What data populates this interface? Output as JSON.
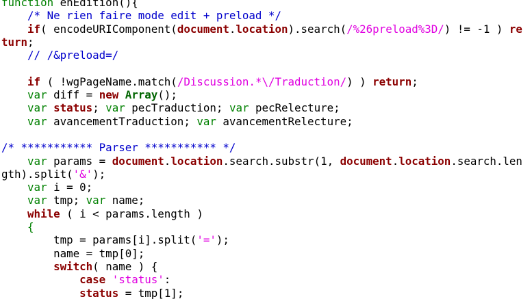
{
  "editor": {
    "language": "javascript",
    "colors": {
      "keyword": "#008000",
      "bold_keyword": "#8b0000",
      "comment": "#0000cc",
      "string": "#e000e0",
      "plain": "#000000",
      "background": "#ffffff"
    },
    "lines": [
      [
        [
          "kw",
          "function"
        ],
        [
          "plain",
          " enEdition(){"
        ]
      ],
      [
        [
          "plain",
          "    "
        ],
        [
          "cm",
          "/* Ne rien faire mode edit + preload */"
        ]
      ],
      [
        [
          "plain",
          "    "
        ],
        [
          "kwb",
          "if"
        ],
        [
          "plain",
          "( encodeURIComponent("
        ],
        [
          "var",
          "document"
        ],
        [
          "plain",
          "."
        ],
        [
          "var",
          "location"
        ],
        [
          "plain",
          ").search("
        ],
        [
          "str",
          "/%26preload%3D/"
        ],
        [
          "plain",
          ") != -1 ) "
        ],
        [
          "kwb",
          "re"
        ]
      ],
      [
        [
          "kwb",
          "turn"
        ],
        [
          "plain",
          ";"
        ]
      ],
      [
        [
          "plain",
          "    "
        ],
        [
          "cm",
          "// /&preload=/"
        ]
      ],
      [
        [
          "plain",
          ""
        ]
      ],
      [
        [
          "plain",
          "    "
        ],
        [
          "kwb",
          "if"
        ],
        [
          "plain",
          " ( !wgPageName.match("
        ],
        [
          "str",
          "/Discussion.*\\/Traduction/"
        ],
        [
          "plain",
          ") ) "
        ],
        [
          "kwb",
          "return"
        ],
        [
          "plain",
          ";"
        ]
      ],
      [
        [
          "plain",
          "    "
        ],
        [
          "kw",
          "var"
        ],
        [
          "plain",
          " diff = "
        ],
        [
          "kwb",
          "new"
        ],
        [
          "plain",
          " "
        ],
        [
          "cls",
          "Array"
        ],
        [
          "plain",
          "();"
        ]
      ],
      [
        [
          "plain",
          "    "
        ],
        [
          "kw",
          "var"
        ],
        [
          "plain",
          " "
        ],
        [
          "var",
          "status"
        ],
        [
          "plain",
          "; "
        ],
        [
          "kw",
          "var"
        ],
        [
          "plain",
          " pecTraduction; "
        ],
        [
          "kw",
          "var"
        ],
        [
          "plain",
          " pecRelecture;"
        ]
      ],
      [
        [
          "plain",
          "    "
        ],
        [
          "kw",
          "var"
        ],
        [
          "plain",
          " avancementTraduction; "
        ],
        [
          "kw",
          "var"
        ],
        [
          "plain",
          " avancementRelecture;"
        ]
      ],
      [
        [
          "plain",
          ""
        ]
      ],
      [
        [
          "cm",
          "/* *********** Parser *********** */"
        ]
      ],
      [
        [
          "plain",
          "    "
        ],
        [
          "kw",
          "var"
        ],
        [
          "plain",
          " params = "
        ],
        [
          "var",
          "document"
        ],
        [
          "plain",
          "."
        ],
        [
          "var",
          "location"
        ],
        [
          "plain",
          ".search.substr(1, "
        ],
        [
          "var",
          "document"
        ],
        [
          "plain",
          "."
        ],
        [
          "var",
          "location"
        ],
        [
          "plain",
          ".search.len"
        ]
      ],
      [
        [
          "plain",
          "gth).split("
        ],
        [
          "str",
          "'&'"
        ],
        [
          "plain",
          ");"
        ]
      ],
      [
        [
          "plain",
          "    "
        ],
        [
          "kw",
          "var"
        ],
        [
          "plain",
          " i = 0;"
        ]
      ],
      [
        [
          "plain",
          "    "
        ],
        [
          "kw",
          "var"
        ],
        [
          "plain",
          " tmp; "
        ],
        [
          "kw",
          "var"
        ],
        [
          "plain",
          " name;"
        ]
      ],
      [
        [
          "plain",
          "    "
        ],
        [
          "kwb",
          "while"
        ],
        [
          "plain",
          " ( i < params.length )"
        ]
      ],
      [
        [
          "plain",
          "    "
        ],
        [
          "kw",
          "{"
        ]
      ],
      [
        [
          "plain",
          "        tmp = params[i].split("
        ],
        [
          "str",
          "'='"
        ],
        [
          "plain",
          ");"
        ]
      ],
      [
        [
          "plain",
          "        name = tmp[0];"
        ]
      ],
      [
        [
          "plain",
          "        "
        ],
        [
          "kwb",
          "switch"
        ],
        [
          "plain",
          "( name ) {"
        ]
      ],
      [
        [
          "plain",
          "            "
        ],
        [
          "kwb",
          "case"
        ],
        [
          "plain",
          " "
        ],
        [
          "str",
          "'status'"
        ],
        [
          "plain",
          ":"
        ]
      ],
      [
        [
          "plain",
          "            "
        ],
        [
          "var",
          "status"
        ],
        [
          "plain",
          " = tmp[1];"
        ]
      ]
    ]
  }
}
